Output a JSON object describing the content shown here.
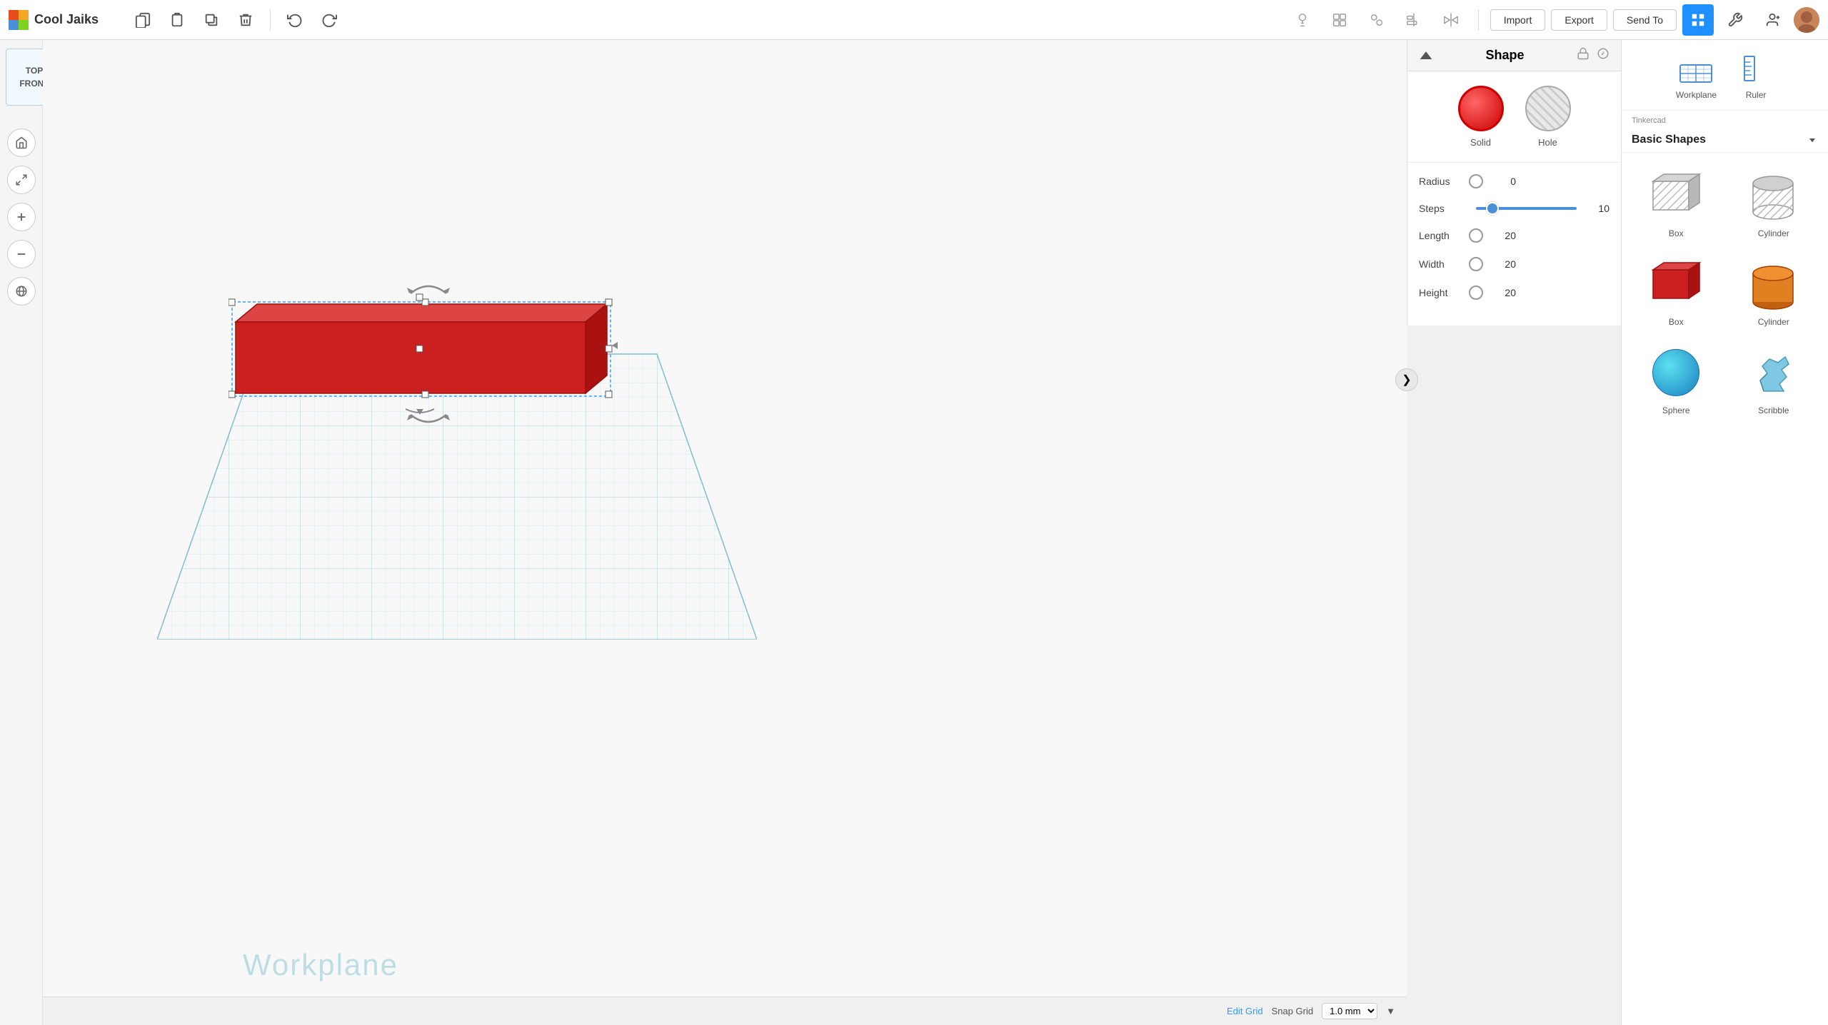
{
  "app": {
    "title": "Cool Jaiks",
    "logo_colors": [
      "#e84d1c",
      "#f5a623",
      "#4a90d9",
      "#7ed321"
    ]
  },
  "topbar": {
    "buttons": {
      "copy_label": "⧉",
      "paste_label": "⊡",
      "duplicate_label": "❏",
      "delete_label": "🗑",
      "undo_label": "↩",
      "redo_label": "↪"
    },
    "right": {
      "import_label": "Import",
      "export_label": "Export",
      "send_to_label": "Send To"
    }
  },
  "toolbar2": {
    "btn1": "💡",
    "btn2": "◻",
    "btn3": "⬡",
    "btn4": "≡",
    "btn5": "⊡"
  },
  "view_cube": {
    "top": "TOP",
    "front": "FRONT"
  },
  "nav": {
    "home": "⌂",
    "fit": "⤢",
    "zoom_in": "+",
    "zoom_out": "−",
    "orientation": "⊕"
  },
  "viewport": {
    "workplane_label": "Workplane"
  },
  "shape_panel": {
    "title": "Shape",
    "solid_label": "Solid",
    "hole_label": "Hole",
    "params": {
      "radius": {
        "label": "Radius",
        "value": 0
      },
      "steps": {
        "label": "Steps",
        "value": 10
      },
      "length": {
        "label": "Length",
        "value": 20
      },
      "width": {
        "label": "Width",
        "value": 20
      },
      "height": {
        "label": "Height",
        "value": 20
      }
    }
  },
  "right_panel": {
    "workplane_label": "Workplane",
    "ruler_label": "Ruler",
    "tinkercad_label": "Tinkercad",
    "dropdown_label": "Basic Shapes",
    "shapes": [
      {
        "label": "Box",
        "type": "box-grey"
      },
      {
        "label": "Cylinder",
        "type": "cylinder-grey"
      },
      {
        "label": "Box",
        "type": "box-red"
      },
      {
        "label": "Cylinder",
        "type": "cylinder-orange"
      },
      {
        "label": "Sphere",
        "type": "sphere-blue"
      },
      {
        "label": "Scribble",
        "type": "scribble"
      }
    ]
  },
  "bottom_bar": {
    "edit_grid_label": "Edit Grid",
    "snap_grid_label": "Snap Grid",
    "snap_value": "1.0 mm"
  }
}
